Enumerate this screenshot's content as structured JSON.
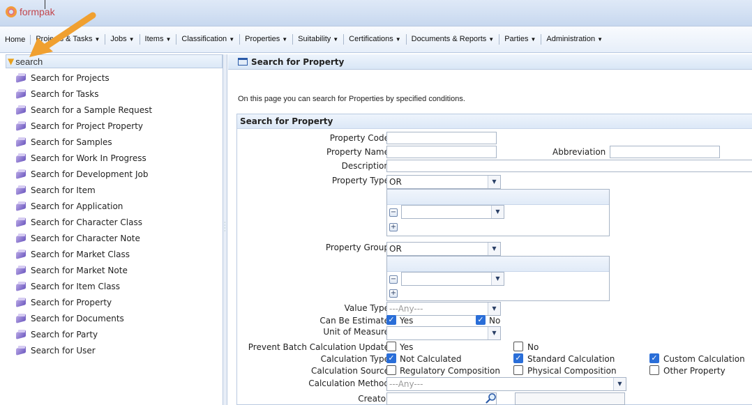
{
  "app": {
    "logo_text": "formpak"
  },
  "menu": [
    {
      "label": "Home",
      "caret": false
    },
    {
      "label": "Projects & Tasks",
      "caret": true
    },
    {
      "label": "Jobs",
      "caret": true
    },
    {
      "label": "Items",
      "caret": true
    },
    {
      "label": "Classification",
      "caret": true
    },
    {
      "label": "Properties",
      "caret": true
    },
    {
      "label": "Suitability",
      "caret": true
    },
    {
      "label": "Certifications",
      "caret": true
    },
    {
      "label": "Documents & Reports",
      "caret": true
    },
    {
      "label": "Parties",
      "caret": true
    },
    {
      "label": "Administration",
      "caret": true
    }
  ],
  "sidebar": {
    "search_value": "search",
    "items": [
      "Search for Projects",
      "Search for Tasks",
      "Search for a Sample Request",
      "Search for Project Property",
      "Search for Samples",
      "Search for Work In Progress",
      "Search for Development Job",
      "Search for Item",
      "Search for Application",
      "Search for Character Class",
      "Search for Character Note",
      "Search for Market Class",
      "Search for Market Note",
      "Search for Item Class",
      "Search for Property",
      "Search for Documents",
      "Search for Party",
      "Search for User"
    ]
  },
  "content": {
    "header": "Search for Property",
    "intro": "On this page you can search for Properties by specified conditions.",
    "panel_title": "Search for Property",
    "labels": {
      "property_code": "Property Code",
      "property_name": "Property Name",
      "abbreviation": "Abbreviation",
      "description": "Description",
      "property_type": "Property Type",
      "property_group": "Property Group",
      "value_type": "Value Type",
      "can_be_estimate": "Can Be Estimate",
      "unit_of_measure": "Unit of Measure",
      "prevent_batch": "Prevent Batch Calculation Update",
      "calculation_type": "Calculation Type",
      "calculation_source": "Calculation Source",
      "calculation_method": "Calculation Method",
      "creator": "Creator"
    },
    "values": {
      "property_type": "OR",
      "property_group": "OR",
      "value_type": "---Any---",
      "calculation_method": "---Any---"
    },
    "options": {
      "yes": "Yes",
      "no": "No",
      "not_calculated": "Not Calculated",
      "standard_calculation": "Standard Calculation",
      "custom_calculation": "Custom Calculation",
      "regulatory_composition": "Regulatory Composition",
      "physical_composition": "Physical Composition",
      "other_property": "Other Property"
    },
    "checks": {
      "can_estimate_yes": true,
      "can_estimate_no": true,
      "prevent_yes": false,
      "prevent_no": false,
      "not_calculated": true,
      "standard_calculation": true,
      "custom_calculation": true,
      "regulatory_composition": false,
      "physical_composition": false,
      "other_property": false
    }
  },
  "colors": {
    "accent": "#2a6ed8",
    "arrow": "#f0a030",
    "logo": "#c2464d"
  }
}
